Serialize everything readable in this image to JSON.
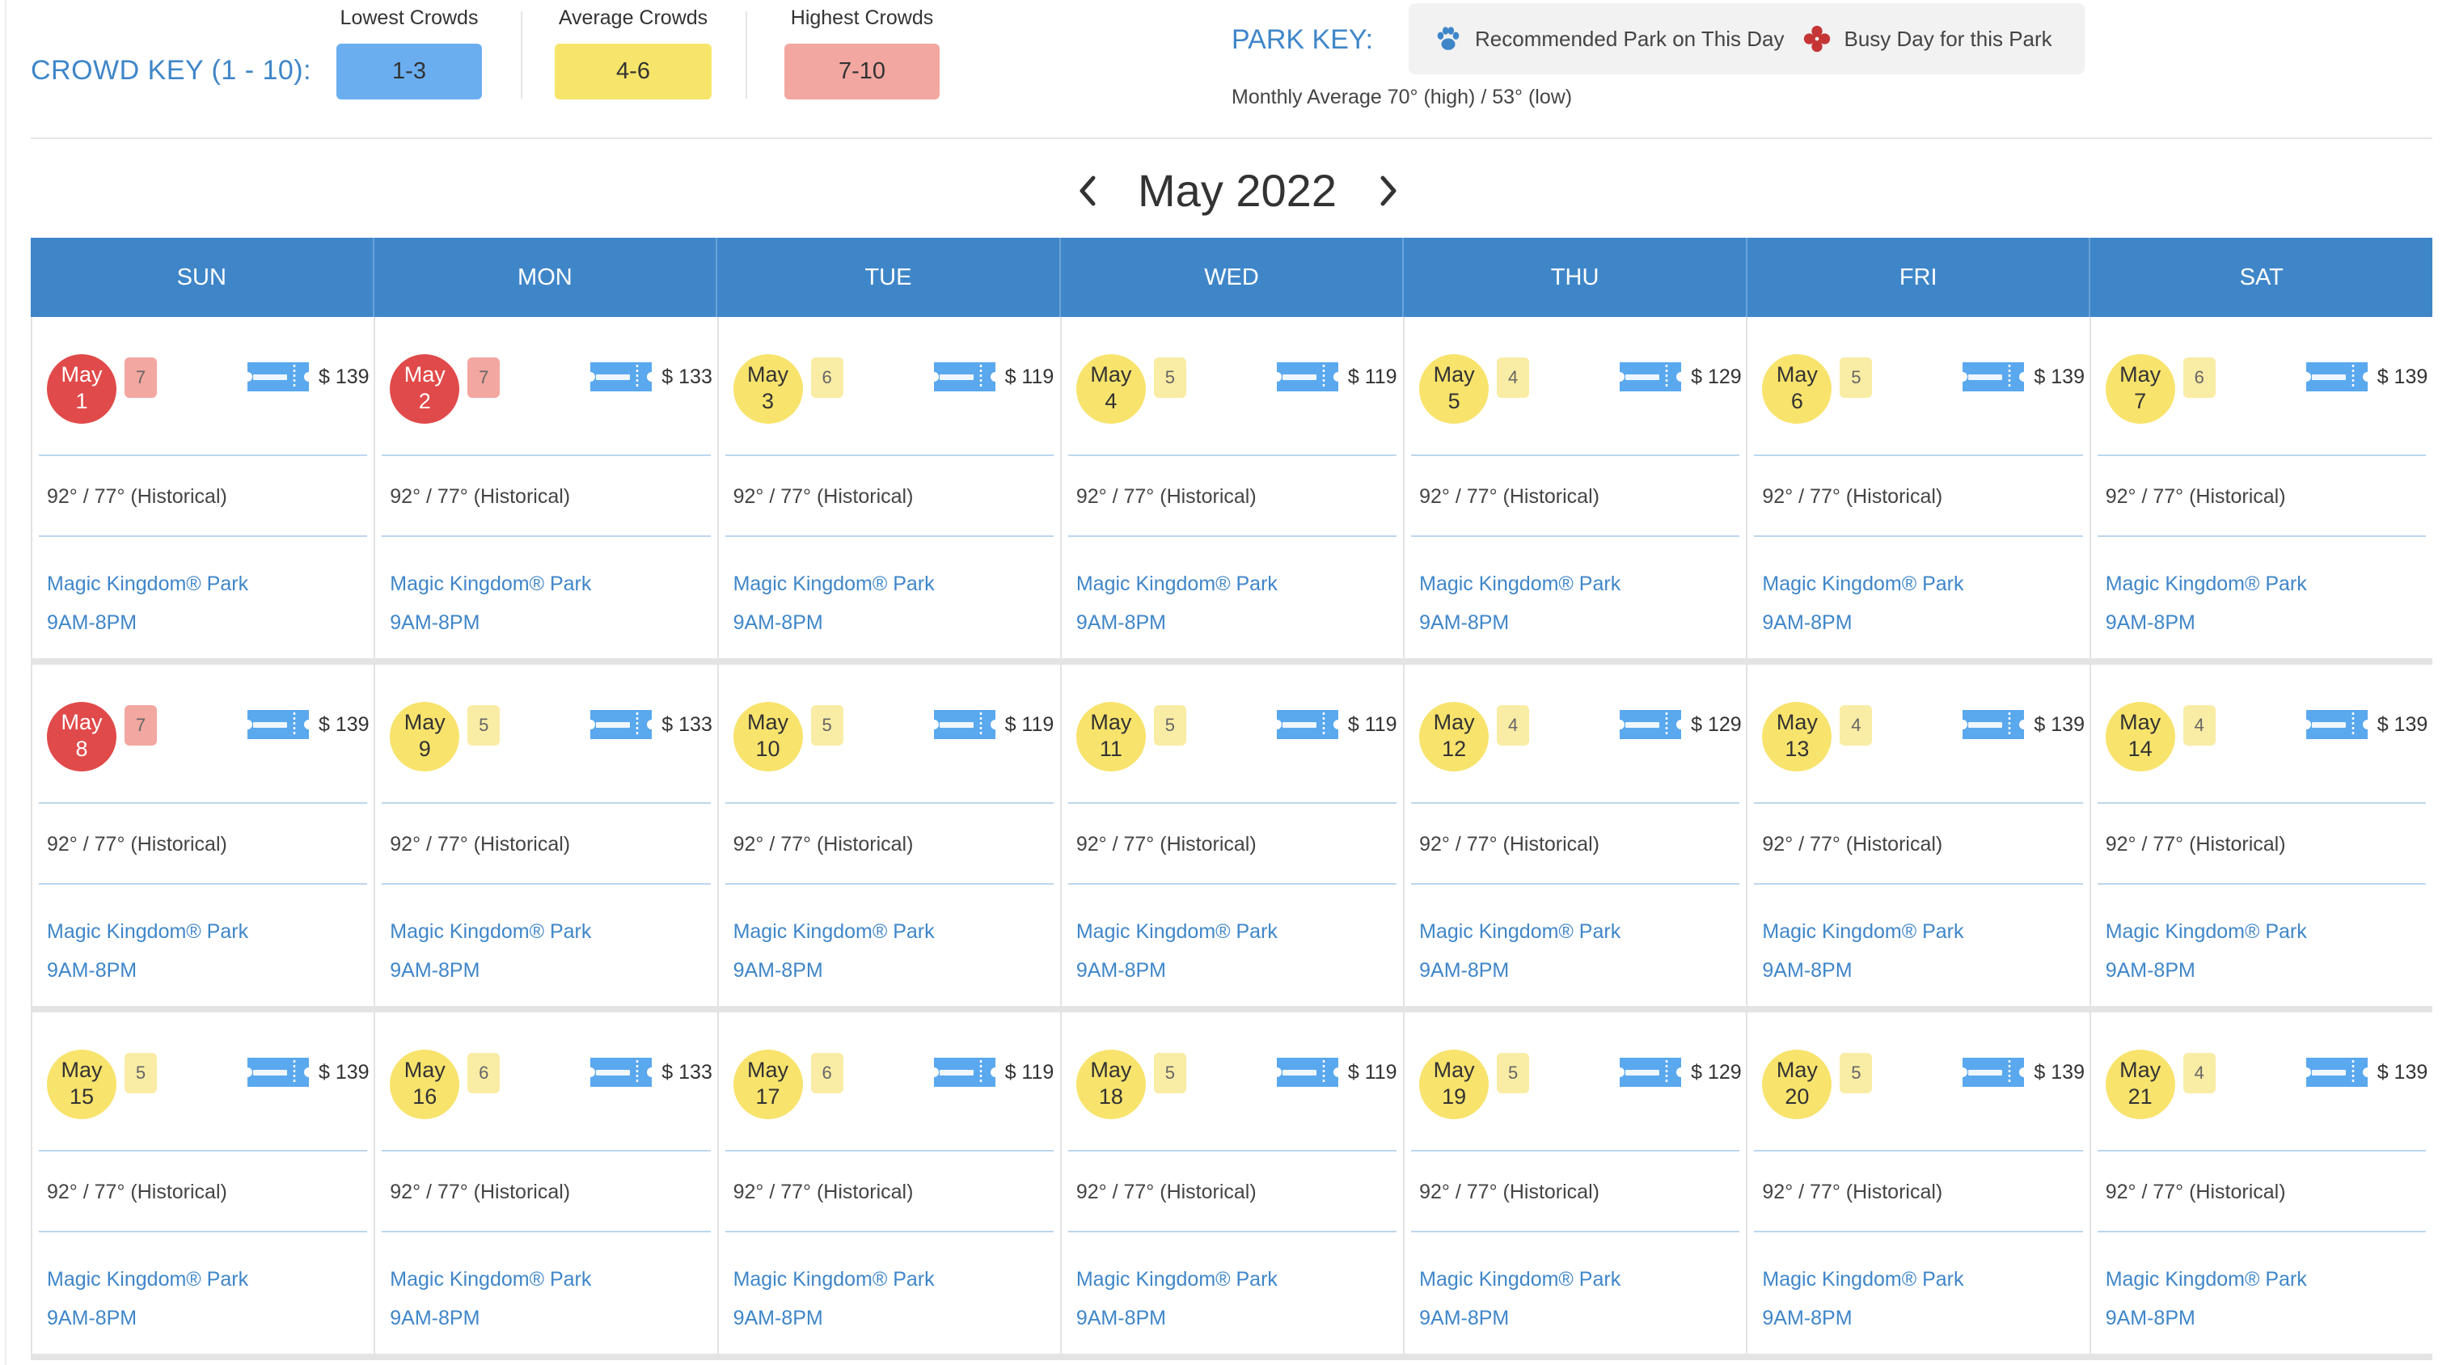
{
  "crowd_key": {
    "title": "CROWD KEY (1 - 10):",
    "items": [
      {
        "label": "Lowest Crowds",
        "range": "1-3",
        "color": "#6aaef0"
      },
      {
        "label": "Average Crowds",
        "range": "4-6",
        "color": "#f6e56a"
      },
      {
        "label": "Highest Crowds",
        "range": "7-10",
        "color": "#f2a7a0"
      }
    ]
  },
  "park_key": {
    "title": "PARK KEY:",
    "recommended_label": "Recommended Park on This Day",
    "recommended_icon": "paw-icon",
    "busy_label": "Busy Day for this Park",
    "busy_icon": "busy-icon",
    "monthly_average": "Monthly Average 70° (high) / 53° (low)"
  },
  "month_nav": {
    "title": "May 2022"
  },
  "weekdays": [
    "SUN",
    "MON",
    "TUE",
    "WED",
    "THU",
    "FRI",
    "SAT"
  ],
  "colors": {
    "header_blue": "#3f86c9",
    "link_blue": "#3f86c9",
    "busy_circle": "#e14a4a",
    "busy_badge": "#f2a7a0",
    "avg_circle": "#f8e36c",
    "avg_badge": "#f9eca4",
    "ticket_blue": "#5aa8ee"
  },
  "weeks": [
    [
      {
        "month": "May",
        "day": "1",
        "crowd": "7",
        "level": "busy",
        "price": "$ 139",
        "weather": "92° / 77° (Historical)",
        "park": "Magic Kingdom® Park",
        "hours": "9AM-8PM"
      },
      {
        "month": "May",
        "day": "2",
        "crowd": "7",
        "level": "busy",
        "price": "$ 133",
        "weather": "92° / 77° (Historical)",
        "park": "Magic Kingdom® Park",
        "hours": "9AM-8PM"
      },
      {
        "month": "May",
        "day": "3",
        "crowd": "6",
        "level": "avg",
        "price": "$ 119",
        "weather": "92° / 77° (Historical)",
        "park": "Magic Kingdom® Park",
        "hours": "9AM-8PM"
      },
      {
        "month": "May",
        "day": "4",
        "crowd": "5",
        "level": "avg",
        "price": "$ 119",
        "weather": "92° / 77° (Historical)",
        "park": "Magic Kingdom® Park",
        "hours": "9AM-8PM"
      },
      {
        "month": "May",
        "day": "5",
        "crowd": "4",
        "level": "avg",
        "price": "$ 129",
        "weather": "92° / 77° (Historical)",
        "park": "Magic Kingdom® Park",
        "hours": "9AM-8PM"
      },
      {
        "month": "May",
        "day": "6",
        "crowd": "5",
        "level": "avg",
        "price": "$ 139",
        "weather": "92° / 77° (Historical)",
        "park": "Magic Kingdom® Park",
        "hours": "9AM-8PM"
      },
      {
        "month": "May",
        "day": "7",
        "crowd": "6",
        "level": "avg",
        "price": "$ 139",
        "weather": "92° / 77° (Historical)",
        "park": "Magic Kingdom® Park",
        "hours": "9AM-8PM"
      }
    ],
    [
      {
        "month": "May",
        "day": "8",
        "crowd": "7",
        "level": "busy",
        "price": "$ 139",
        "weather": "92° / 77° (Historical)",
        "park": "Magic Kingdom® Park",
        "hours": "9AM-8PM"
      },
      {
        "month": "May",
        "day": "9",
        "crowd": "5",
        "level": "avg",
        "price": "$ 133",
        "weather": "92° / 77° (Historical)",
        "park": "Magic Kingdom® Park",
        "hours": "9AM-8PM"
      },
      {
        "month": "May",
        "day": "10",
        "crowd": "5",
        "level": "avg",
        "price": "$ 119",
        "weather": "92° / 77° (Historical)",
        "park": "Magic Kingdom® Park",
        "hours": "9AM-8PM"
      },
      {
        "month": "May",
        "day": "11",
        "crowd": "5",
        "level": "avg",
        "price": "$ 119",
        "weather": "92° / 77° (Historical)",
        "park": "Magic Kingdom® Park",
        "hours": "9AM-8PM"
      },
      {
        "month": "May",
        "day": "12",
        "crowd": "4",
        "level": "avg",
        "price": "$ 129",
        "weather": "92° / 77° (Historical)",
        "park": "Magic Kingdom® Park",
        "hours": "9AM-8PM"
      },
      {
        "month": "May",
        "day": "13",
        "crowd": "4",
        "level": "avg",
        "price": "$ 139",
        "weather": "92° / 77° (Historical)",
        "park": "Magic Kingdom® Park",
        "hours": "9AM-8PM"
      },
      {
        "month": "May",
        "day": "14",
        "crowd": "4",
        "level": "avg",
        "price": "$ 139",
        "weather": "92° / 77° (Historical)",
        "park": "Magic Kingdom® Park",
        "hours": "9AM-8PM"
      }
    ],
    [
      {
        "month": "May",
        "day": "15",
        "crowd": "5",
        "level": "avg",
        "price": "$ 139",
        "weather": "92° / 77° (Historical)",
        "park": "Magic Kingdom® Park",
        "hours": "9AM-8PM"
      },
      {
        "month": "May",
        "day": "16",
        "crowd": "6",
        "level": "avg",
        "price": "$ 133",
        "weather": "92° / 77° (Historical)",
        "park": "Magic Kingdom® Park",
        "hours": "9AM-8PM"
      },
      {
        "month": "May",
        "day": "17",
        "crowd": "6",
        "level": "avg",
        "price": "$ 119",
        "weather": "92° / 77° (Historical)",
        "park": "Magic Kingdom® Park",
        "hours": "9AM-8PM"
      },
      {
        "month": "May",
        "day": "18",
        "crowd": "5",
        "level": "avg",
        "price": "$ 119",
        "weather": "92° / 77° (Historical)",
        "park": "Magic Kingdom® Park",
        "hours": "9AM-8PM"
      },
      {
        "month": "May",
        "day": "19",
        "crowd": "5",
        "level": "avg",
        "price": "$ 129",
        "weather": "92° / 77° (Historical)",
        "park": "Magic Kingdom® Park",
        "hours": "9AM-8PM"
      },
      {
        "month": "May",
        "day": "20",
        "crowd": "5",
        "level": "avg",
        "price": "$ 139",
        "weather": "92° / 77° (Historical)",
        "park": "Magic Kingdom® Park",
        "hours": "9AM-8PM"
      },
      {
        "month": "May",
        "day": "21",
        "crowd": "4",
        "level": "avg",
        "price": "$ 139",
        "weather": "92° / 77° (Historical)",
        "park": "Magic Kingdom® Park",
        "hours": "9AM-8PM"
      }
    ]
  ]
}
